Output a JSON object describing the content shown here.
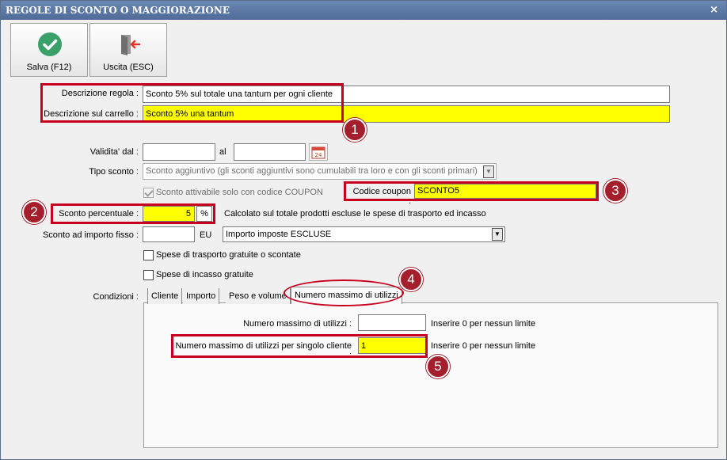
{
  "window": {
    "title": "REGOLE DI SCONTO O MAGGIORAZIONE",
    "close_glyph": "×"
  },
  "toolbar": {
    "save_label": "Salva (F12)",
    "exit_label": "Uscita (ESC)",
    "save_icon": "checkmark-circle-icon",
    "exit_icon": "exit-door-icon"
  },
  "form": {
    "descrizione_regola_label": "Descrizione regola :",
    "descrizione_regola_value": "Sconto 5% sul totale una tantum per ogni cliente",
    "descrizione_carrello_label": "Descrizione sul carrello :",
    "descrizione_carrello_value": "Sconto 5% una tantum",
    "validita_label": "Validita' dal :",
    "al_label": "al",
    "validita_from": "",
    "validita_to": "",
    "calendar_badge": "24",
    "tipo_sconto_label": "Tipo sconto :",
    "tipo_sconto_value": "Sconto aggiuntivo (gli sconti aggiuntivi sono cumulabili tra loro e con gli sconti primari)",
    "coupon_checkbox_label": "Sconto attivabile solo con codice COUPON",
    "codice_coupon_label": "Codice coupon :",
    "codice_coupon_value": "SCONTO5",
    "sconto_percentuale_label": "Sconto percentuale :",
    "sconto_percentuale_value": "5",
    "percent_sign": "%",
    "calcolato_note": "Calcolato sul totale prodotti escluse le spese di trasporto ed incasso",
    "importo_fisso_label": "Sconto ad importo fisso :",
    "importo_fisso_value": "",
    "eu_label": "EU",
    "imposte_value": "Importo imposte ESCLUSE",
    "spese_trasporto_label": "Spese di trasporto gratuite o scontate",
    "spese_incasso_label": "Spese di incasso gratuite",
    "condizioni_label": "Condizioni :"
  },
  "tabs": [
    {
      "label": "Cliente"
    },
    {
      "label": "Importo"
    },
    {
      "label": "Peso e volume"
    },
    {
      "label": "Numero massimo di utilizzi"
    }
  ],
  "panel": {
    "max_utilizzi_label": "Numero massimo di utilizzi :",
    "max_utilizzi_value": "",
    "max_utilizzi_note": "Inserire 0 per nessun limite",
    "max_cliente_label": "Numero massimo di utilizzi per singolo cliente :",
    "max_cliente_value": "1",
    "max_cliente_note": "Inserire 0 per nessun limite"
  },
  "markers": [
    "1",
    "2",
    "3",
    "4",
    "5"
  ],
  "colors": {
    "highlight": "#ffff00",
    "annotation_red": "#c8001e",
    "marker": "#a51e2c",
    "titlebar": "#5b78a6"
  }
}
